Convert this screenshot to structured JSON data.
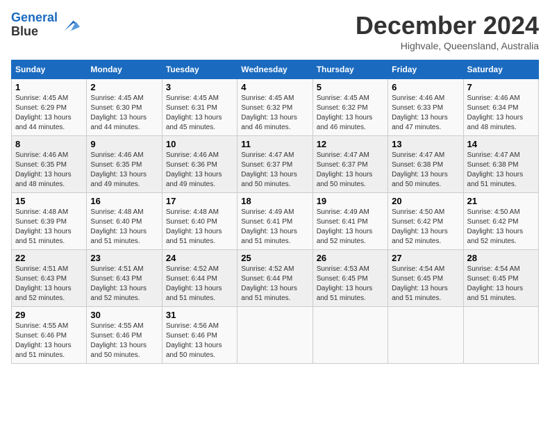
{
  "header": {
    "logo_line1": "General",
    "logo_line2": "Blue",
    "month_title": "December 2024",
    "subtitle": "Highvale, Queensland, Australia"
  },
  "columns": [
    "Sunday",
    "Monday",
    "Tuesday",
    "Wednesday",
    "Thursday",
    "Friday",
    "Saturday"
  ],
  "weeks": [
    [
      {
        "day": "1",
        "sunrise": "4:45 AM",
        "sunset": "6:29 PM",
        "daylight": "13 hours and 44 minutes."
      },
      {
        "day": "2",
        "sunrise": "4:45 AM",
        "sunset": "6:30 PM",
        "daylight": "13 hours and 44 minutes."
      },
      {
        "day": "3",
        "sunrise": "4:45 AM",
        "sunset": "6:31 PM",
        "daylight": "13 hours and 45 minutes."
      },
      {
        "day": "4",
        "sunrise": "4:45 AM",
        "sunset": "6:32 PM",
        "daylight": "13 hours and 46 minutes."
      },
      {
        "day": "5",
        "sunrise": "4:45 AM",
        "sunset": "6:32 PM",
        "daylight": "13 hours and 46 minutes."
      },
      {
        "day": "6",
        "sunrise": "4:46 AM",
        "sunset": "6:33 PM",
        "daylight": "13 hours and 47 minutes."
      },
      {
        "day": "7",
        "sunrise": "4:46 AM",
        "sunset": "6:34 PM",
        "daylight": "13 hours and 48 minutes."
      }
    ],
    [
      {
        "day": "8",
        "sunrise": "4:46 AM",
        "sunset": "6:35 PM",
        "daylight": "13 hours and 48 minutes."
      },
      {
        "day": "9",
        "sunrise": "4:46 AM",
        "sunset": "6:35 PM",
        "daylight": "13 hours and 49 minutes."
      },
      {
        "day": "10",
        "sunrise": "4:46 AM",
        "sunset": "6:36 PM",
        "daylight": "13 hours and 49 minutes."
      },
      {
        "day": "11",
        "sunrise": "4:47 AM",
        "sunset": "6:37 PM",
        "daylight": "13 hours and 50 minutes."
      },
      {
        "day": "12",
        "sunrise": "4:47 AM",
        "sunset": "6:37 PM",
        "daylight": "13 hours and 50 minutes."
      },
      {
        "day": "13",
        "sunrise": "4:47 AM",
        "sunset": "6:38 PM",
        "daylight": "13 hours and 50 minutes."
      },
      {
        "day": "14",
        "sunrise": "4:47 AM",
        "sunset": "6:38 PM",
        "daylight": "13 hours and 51 minutes."
      }
    ],
    [
      {
        "day": "15",
        "sunrise": "4:48 AM",
        "sunset": "6:39 PM",
        "daylight": "13 hours and 51 minutes."
      },
      {
        "day": "16",
        "sunrise": "4:48 AM",
        "sunset": "6:40 PM",
        "daylight": "13 hours and 51 minutes."
      },
      {
        "day": "17",
        "sunrise": "4:48 AM",
        "sunset": "6:40 PM",
        "daylight": "13 hours and 51 minutes."
      },
      {
        "day": "18",
        "sunrise": "4:49 AM",
        "sunset": "6:41 PM",
        "daylight": "13 hours and 51 minutes."
      },
      {
        "day": "19",
        "sunrise": "4:49 AM",
        "sunset": "6:41 PM",
        "daylight": "13 hours and 52 minutes."
      },
      {
        "day": "20",
        "sunrise": "4:50 AM",
        "sunset": "6:42 PM",
        "daylight": "13 hours and 52 minutes."
      },
      {
        "day": "21",
        "sunrise": "4:50 AM",
        "sunset": "6:42 PM",
        "daylight": "13 hours and 52 minutes."
      }
    ],
    [
      {
        "day": "22",
        "sunrise": "4:51 AM",
        "sunset": "6:43 PM",
        "daylight": "13 hours and 52 minutes."
      },
      {
        "day": "23",
        "sunrise": "4:51 AM",
        "sunset": "6:43 PM",
        "daylight": "13 hours and 52 minutes."
      },
      {
        "day": "24",
        "sunrise": "4:52 AM",
        "sunset": "6:44 PM",
        "daylight": "13 hours and 51 minutes."
      },
      {
        "day": "25",
        "sunrise": "4:52 AM",
        "sunset": "6:44 PM",
        "daylight": "13 hours and 51 minutes."
      },
      {
        "day": "26",
        "sunrise": "4:53 AM",
        "sunset": "6:45 PM",
        "daylight": "13 hours and 51 minutes."
      },
      {
        "day": "27",
        "sunrise": "4:54 AM",
        "sunset": "6:45 PM",
        "daylight": "13 hours and 51 minutes."
      },
      {
        "day": "28",
        "sunrise": "4:54 AM",
        "sunset": "6:45 PM",
        "daylight": "13 hours and 51 minutes."
      }
    ],
    [
      {
        "day": "29",
        "sunrise": "4:55 AM",
        "sunset": "6:46 PM",
        "daylight": "13 hours and 51 minutes."
      },
      {
        "day": "30",
        "sunrise": "4:55 AM",
        "sunset": "6:46 PM",
        "daylight": "13 hours and 50 minutes."
      },
      {
        "day": "31",
        "sunrise": "4:56 AM",
        "sunset": "6:46 PM",
        "daylight": "13 hours and 50 minutes."
      },
      null,
      null,
      null,
      null
    ]
  ]
}
